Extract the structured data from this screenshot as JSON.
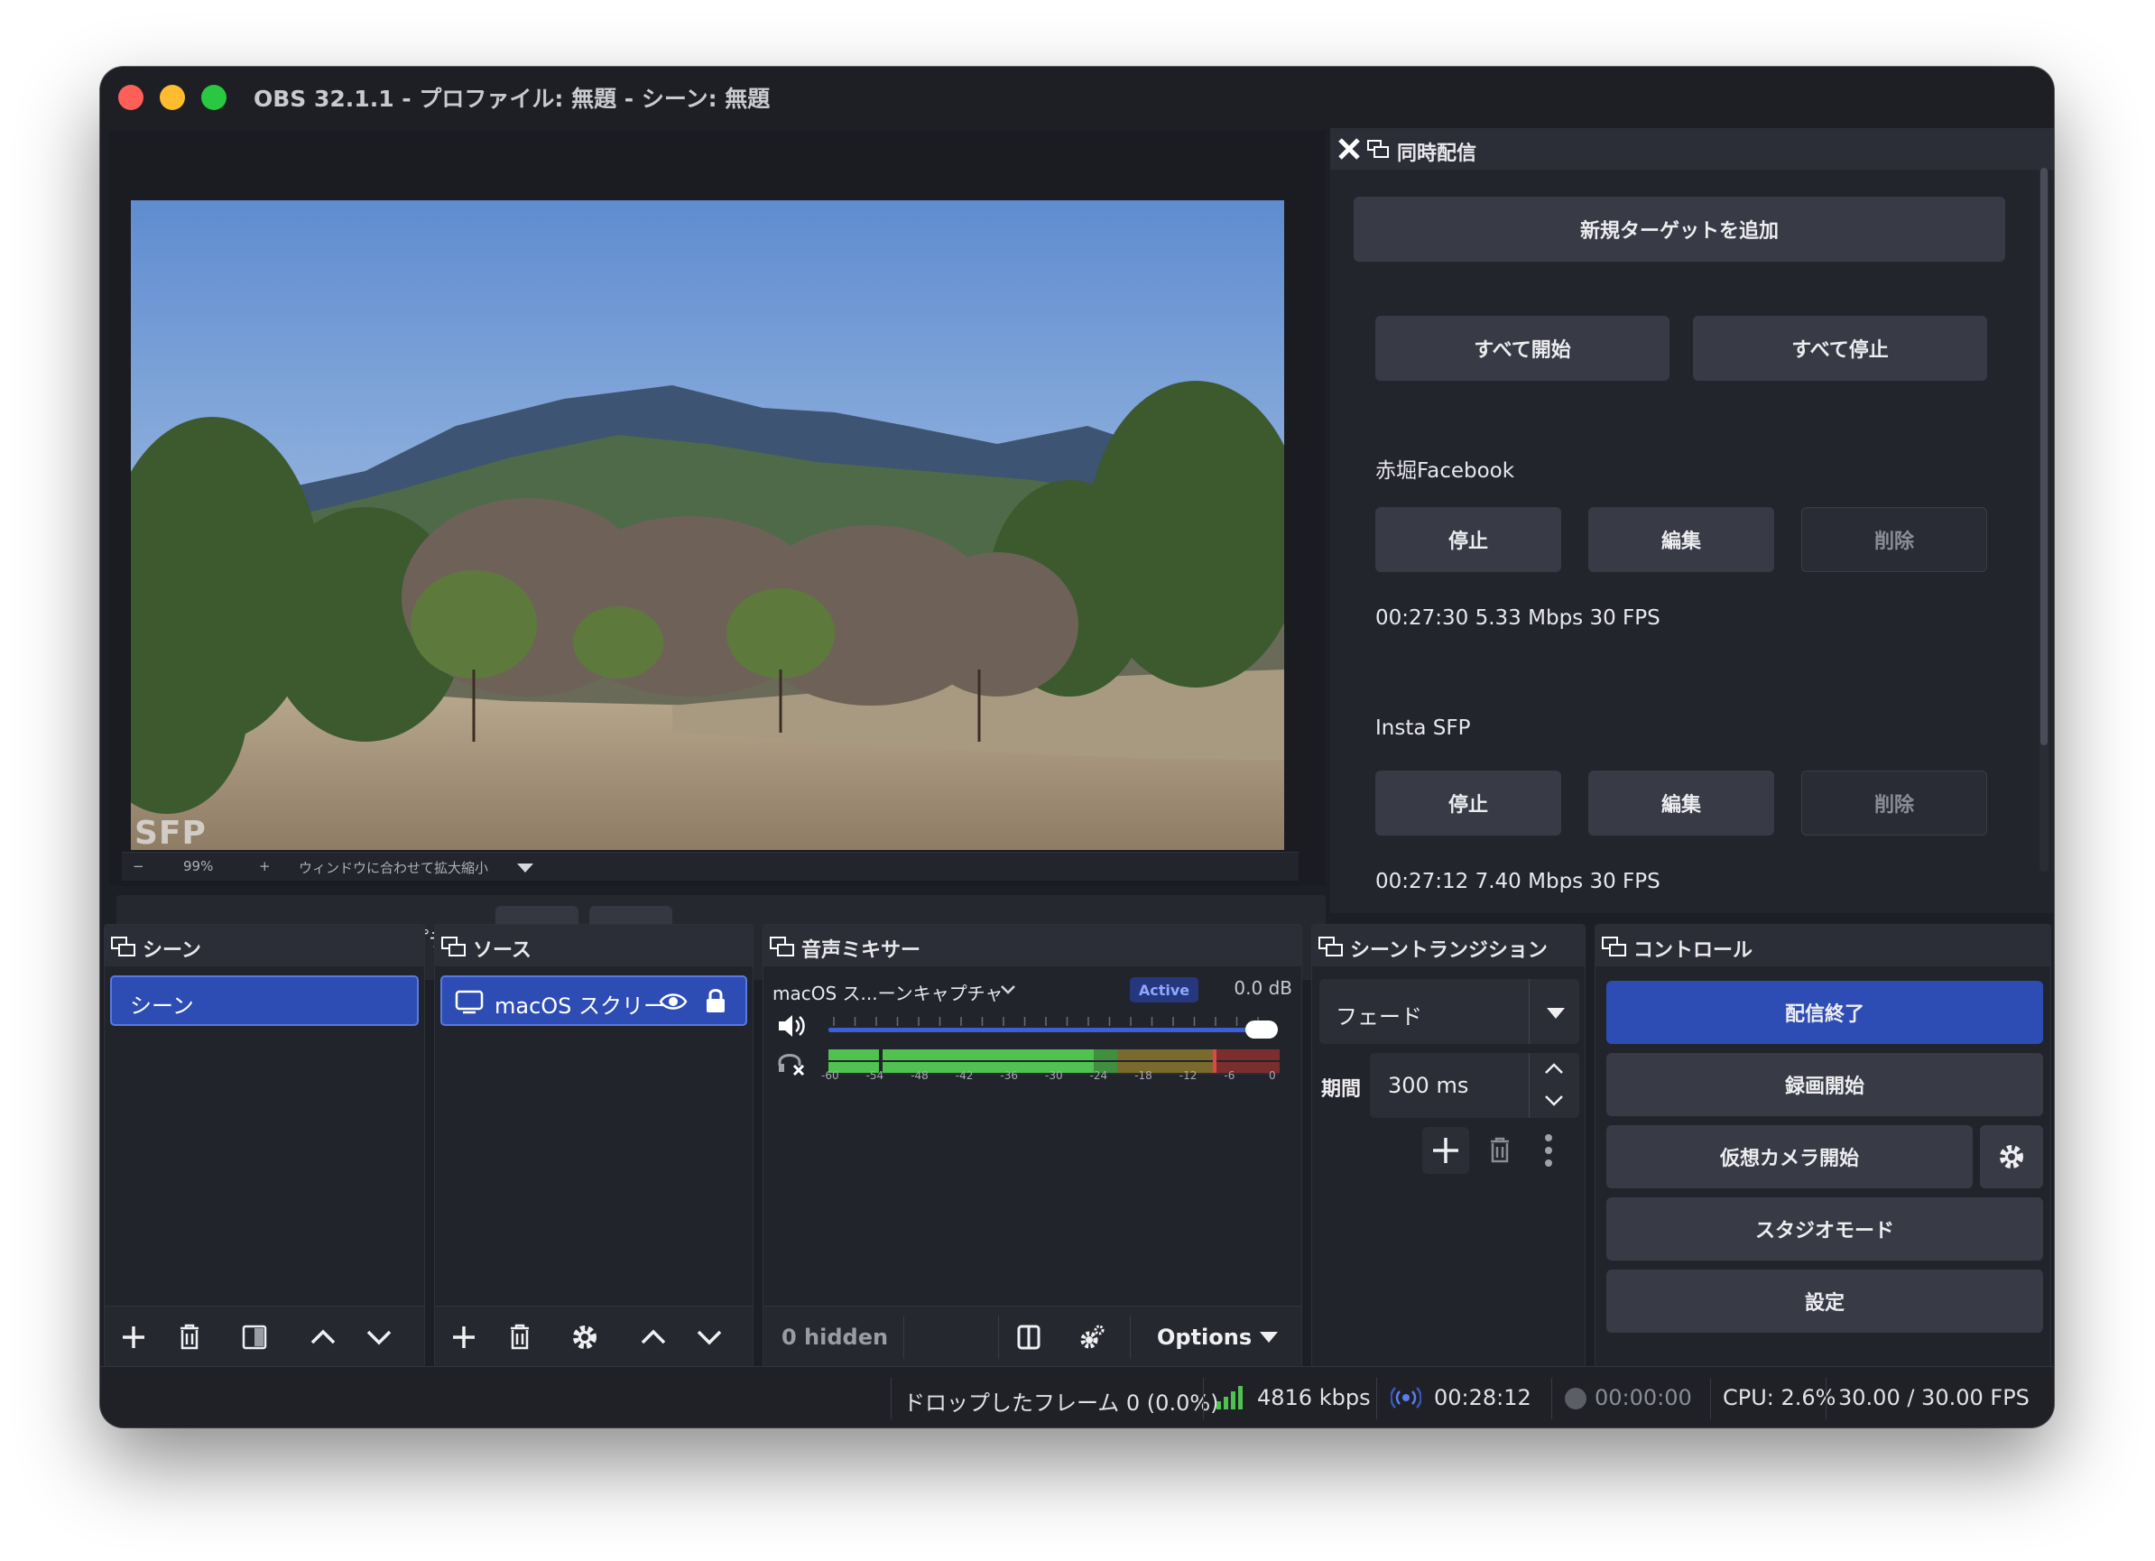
{
  "window": {
    "title": "OBS 32.1.1 - プロファイル: 無題 - シーン: 無題"
  },
  "preview": {
    "overlay_text": "SFP",
    "zoom": {
      "minus": "−",
      "value": "99%",
      "plus": "+",
      "fit_label": "ウィンドウに合わせて拡大縮小"
    }
  },
  "context_bar": {
    "source_name": "macOS スクリーンキャプチャ"
  },
  "multistream": {
    "title": "同時配信",
    "add_target": "新規ターゲットを追加",
    "start_all": "すべて開始",
    "stop_all": "すべて停止",
    "targets": [
      {
        "name": "赤堀Facebook",
        "stop": "停止",
        "edit": "編集",
        "delete": "削除",
        "stats": "00:27:30  5.33 Mbps  30 FPS"
      },
      {
        "name": "Insta SFP",
        "stop": "停止",
        "edit": "編集",
        "delete": "削除",
        "stats": "00:27:12  7.40 Mbps  30 FPS"
      }
    ]
  },
  "scenes": {
    "title": "シーン",
    "items": [
      "シーン"
    ]
  },
  "sources": {
    "title": "ソース",
    "items": [
      "macOS スクリー"
    ]
  },
  "mixer": {
    "title": "音声ミキサー",
    "channel_name": "macOS ス...ーンキャプチャ",
    "badge": "Active",
    "db": "0.0 dB",
    "volume_level": 0.98,
    "ticks": [
      "-60",
      "-54",
      "-48",
      "-42",
      "-36",
      "-30",
      "-24",
      "-18",
      "-12",
      "-6",
      "0"
    ],
    "hidden": "0 hidden",
    "options": "Options"
  },
  "transitions": {
    "title": "シーントランジション",
    "selected": "フェード",
    "duration_label": "期間",
    "duration": "300 ms"
  },
  "controls": {
    "title": "コントロール",
    "stop_stream": "配信終了",
    "start_record": "録画開始",
    "start_virtual_cam": "仮想カメラ開始",
    "studio_mode": "スタジオモード",
    "settings": "設定"
  },
  "status": {
    "dropped": "ドロップしたフレーム 0 (0.0%)",
    "bitrate": "4816 kbps",
    "stream_time": "00:28:12",
    "record_time": "00:00:00",
    "cpu": "CPU: 2.6%",
    "fps": "30.00 / 30.00 FPS"
  },
  "colors": {
    "accent": "#2e4db4",
    "window_bg": "#1d1f26",
    "meter_green": "#4fc24f",
    "meter_yellow": "#c9a83a",
    "meter_red": "#c94040"
  }
}
